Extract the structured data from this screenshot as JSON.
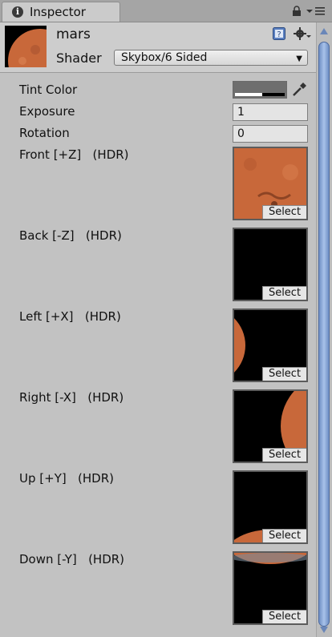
{
  "tab": {
    "label": "Inspector",
    "icon": "info-icon"
  },
  "material": {
    "name": "mars"
  },
  "shader": {
    "label": "Shader",
    "value": "Skybox/6 Sided"
  },
  "properties": {
    "tint_color": {
      "label": "Tint Color",
      "color": "#6e6e6e"
    },
    "exposure": {
      "label": "Exposure",
      "value": "1"
    },
    "rotation": {
      "label": "Rotation",
      "value": "0"
    }
  },
  "textures": [
    {
      "label": "Front [+Z]   (HDR)",
      "button": "Select"
    },
    {
      "label": "Back [-Z]   (HDR)",
      "button": "Select"
    },
    {
      "label": "Left [+X]   (HDR)",
      "button": "Select"
    },
    {
      "label": "Right [-X]   (HDR)",
      "button": "Select"
    },
    {
      "label": "Up [+Y]   (HDR)",
      "button": "Select"
    },
    {
      "label": "Down [-Y]   (HDR)",
      "button": "Select"
    }
  ],
  "colors": {
    "mars": "#c8683a",
    "scrollbar": "#8aa8d8",
    "panel": "#c2c2c2"
  }
}
